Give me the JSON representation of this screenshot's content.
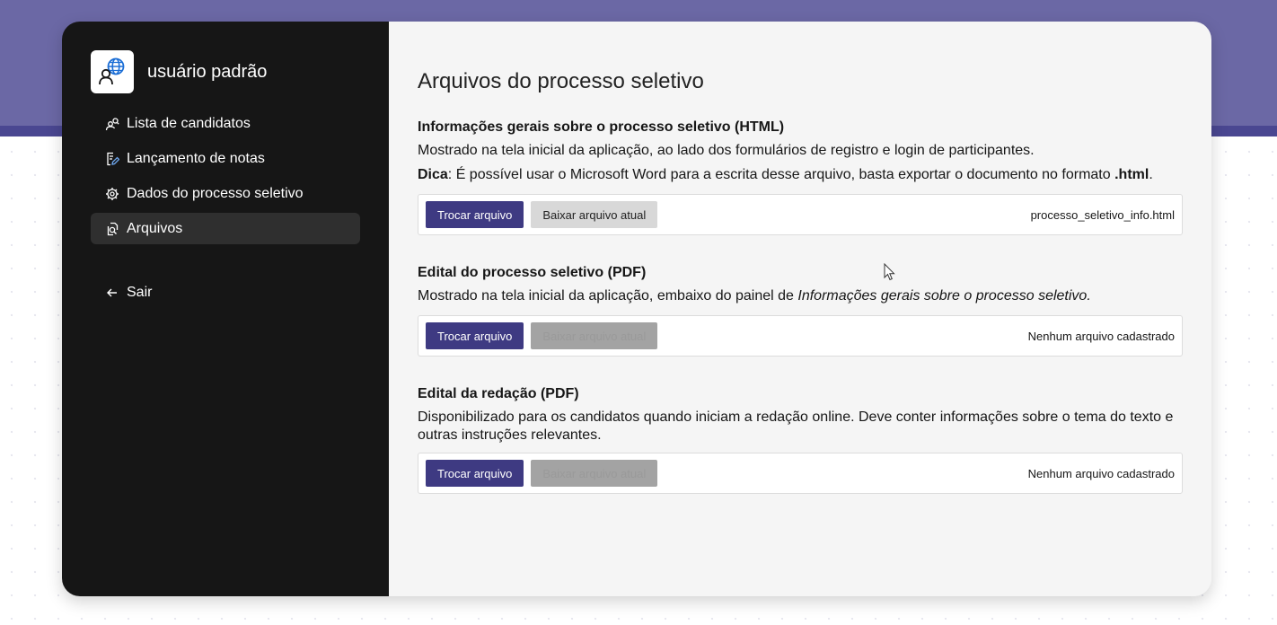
{
  "sidebar": {
    "user_name": "usuário padrão",
    "items": [
      {
        "label": "Lista de candidatos",
        "icon": "user-search-icon"
      },
      {
        "label": "Lançamento de notas",
        "icon": "document-edit-icon"
      },
      {
        "label": "Dados do processo seletivo",
        "icon": "gear-icon"
      },
      {
        "label": "Arquivos",
        "icon": "file-search-icon",
        "active": true
      }
    ],
    "logout_label": "Sair"
  },
  "main": {
    "title": "Arquivos do processo seletivo",
    "sections": [
      {
        "title": "Informações gerais sobre o processo seletivo (HTML)",
        "description": "Mostrado na tela inicial da aplicação, ao lado dos formulários de registro e login de participantes.",
        "tip_label": "Dica",
        "tip_text": ": É possível usar o Microsoft Word para a escrita desse arquivo, basta exportar o documento no formato ",
        "tip_format": ".html",
        "tip_end": ".",
        "change_label": "Trocar arquivo",
        "download_label": "Baixar arquivo atual",
        "download_enabled": true,
        "file_name": "processo_seletivo_info.html"
      },
      {
        "title": "Edital do processo seletivo (PDF)",
        "description_prefix": "Mostrado na tela inicial da aplicação, embaixo do painel de ",
        "description_italic": "Informações gerais sobre o processo seletivo.",
        "change_label": "Trocar arquivo",
        "download_label": "Baixar arquivo atual",
        "download_enabled": false,
        "file_name": "Nenhum arquivo cadastrado"
      },
      {
        "title": "Edital da redação (PDF)",
        "description_line1": "Disponibilizado para os candidatos quando iniciam a redação online. Deve conter informações sobre o tema do texto e",
        "description_line2": "outras instruções relevantes.",
        "change_label": "Trocar arquivo",
        "download_label": "Baixar arquivo atual",
        "download_enabled": false,
        "file_name": "Nenhum arquivo cadastrado"
      }
    ]
  },
  "colors": {
    "banner": "#6b68a5",
    "sidebar": "#161616",
    "primary_button": "#3e3a82",
    "content_bg": "#f5f5f5"
  }
}
